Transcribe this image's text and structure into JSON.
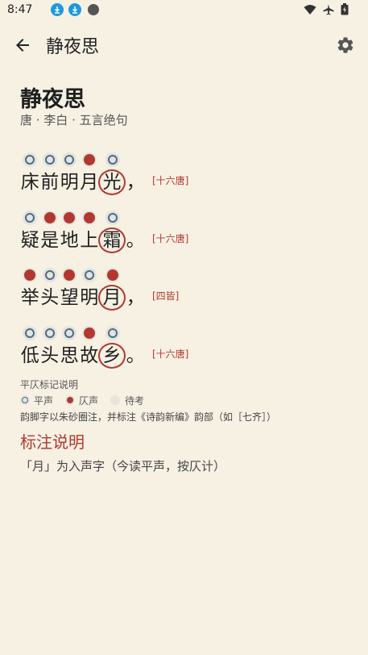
{
  "status_bar": {
    "time": "8:47"
  },
  "app_bar": {
    "title": "静夜思"
  },
  "poem": {
    "title": "静夜思",
    "meta": "唐 · 李白 · 五言绝句",
    "lines": [
      {
        "chars": [
          "床",
          "前",
          "明",
          "月",
          "光",
          "，"
        ],
        "tones": [
          "ping",
          "ping",
          "ping",
          "ze",
          "ping"
        ],
        "rhyme_tag": "[十六唐]"
      },
      {
        "chars": [
          "疑",
          "是",
          "地",
          "上",
          "霜",
          "。"
        ],
        "tones": [
          "ping",
          "ze",
          "ze",
          "ze",
          "ping"
        ],
        "rhyme_tag": "[十六唐]"
      },
      {
        "chars": [
          "举",
          "头",
          "望",
          "明",
          "月",
          "，"
        ],
        "tones": [
          "ze",
          "ping",
          "ze",
          "ping",
          "ze"
        ],
        "rhyme_tag": "[四皆]"
      },
      {
        "chars": [
          "低",
          "头",
          "思",
          "故",
          "乡",
          "。"
        ],
        "tones": [
          "ping",
          "ping",
          "ping",
          "ze",
          "ping"
        ],
        "rhyme_tag": "[十六唐]"
      }
    ]
  },
  "legend": {
    "title": "平仄标记说明",
    "ping_label": "平声",
    "ze_label": "仄声",
    "pending_label": "待考",
    "note": "韵脚字以朱砂圈注，并标注《诗韵新编》韵部（如［七齐］）"
  },
  "notes": {
    "heading": "标注说明",
    "body": "「月」为入声字（今读平声，按仄计）"
  },
  "colors": {
    "background": "#f7f1e4",
    "accent": "#b2382f",
    "ping": "#4f6b84"
  }
}
